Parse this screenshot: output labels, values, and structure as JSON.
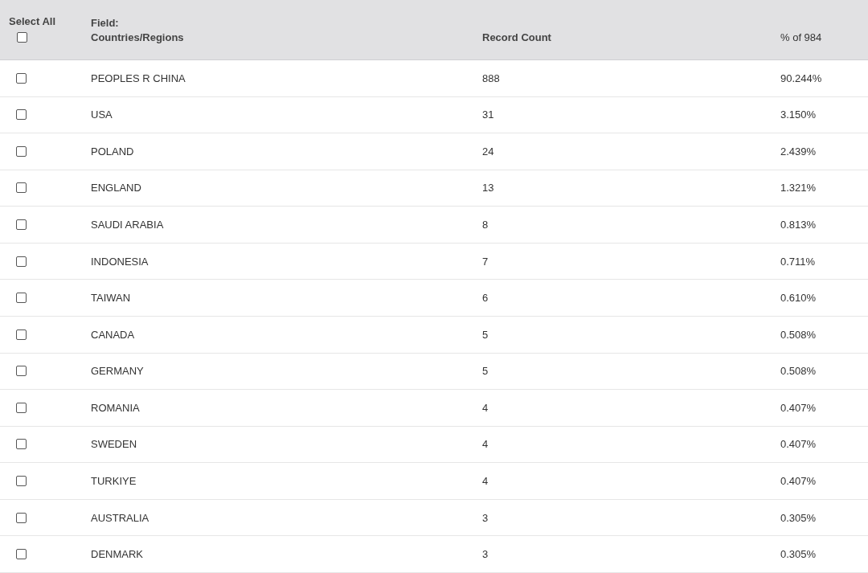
{
  "header": {
    "select_all": {
      "label": "Select All",
      "checked": false
    },
    "field_label": "Field:",
    "field_name": "Countries/Regions",
    "count_label": "Record Count",
    "percent_label": "% of 984"
  },
  "rows": [
    {
      "name": "PEOPLES R CHINA",
      "count": "888",
      "percent": "90.244%",
      "checked": false
    },
    {
      "name": "USA",
      "count": "31",
      "percent": "3.150%",
      "checked": false
    },
    {
      "name": "POLAND",
      "count": "24",
      "percent": "2.439%",
      "checked": false
    },
    {
      "name": "ENGLAND",
      "count": "13",
      "percent": "1.321%",
      "checked": false
    },
    {
      "name": "SAUDI ARABIA",
      "count": "8",
      "percent": "0.813%",
      "checked": false
    },
    {
      "name": "INDONESIA",
      "count": "7",
      "percent": "0.711%",
      "checked": false
    },
    {
      "name": "TAIWAN",
      "count": "6",
      "percent": "0.610%",
      "checked": false
    },
    {
      "name": "CANADA",
      "count": "5",
      "percent": "0.508%",
      "checked": false
    },
    {
      "name": "GERMANY",
      "count": "5",
      "percent": "0.508%",
      "checked": false
    },
    {
      "name": "ROMANIA",
      "count": "4",
      "percent": "0.407%",
      "checked": false
    },
    {
      "name": "SWEDEN",
      "count": "4",
      "percent": "0.407%",
      "checked": false
    },
    {
      "name": "TURKIYE",
      "count": "4",
      "percent": "0.407%",
      "checked": false
    },
    {
      "name": "AUSTRALIA",
      "count": "3",
      "percent": "0.305%",
      "checked": false
    },
    {
      "name": "DENMARK",
      "count": "3",
      "percent": "0.305%",
      "checked": false
    }
  ]
}
